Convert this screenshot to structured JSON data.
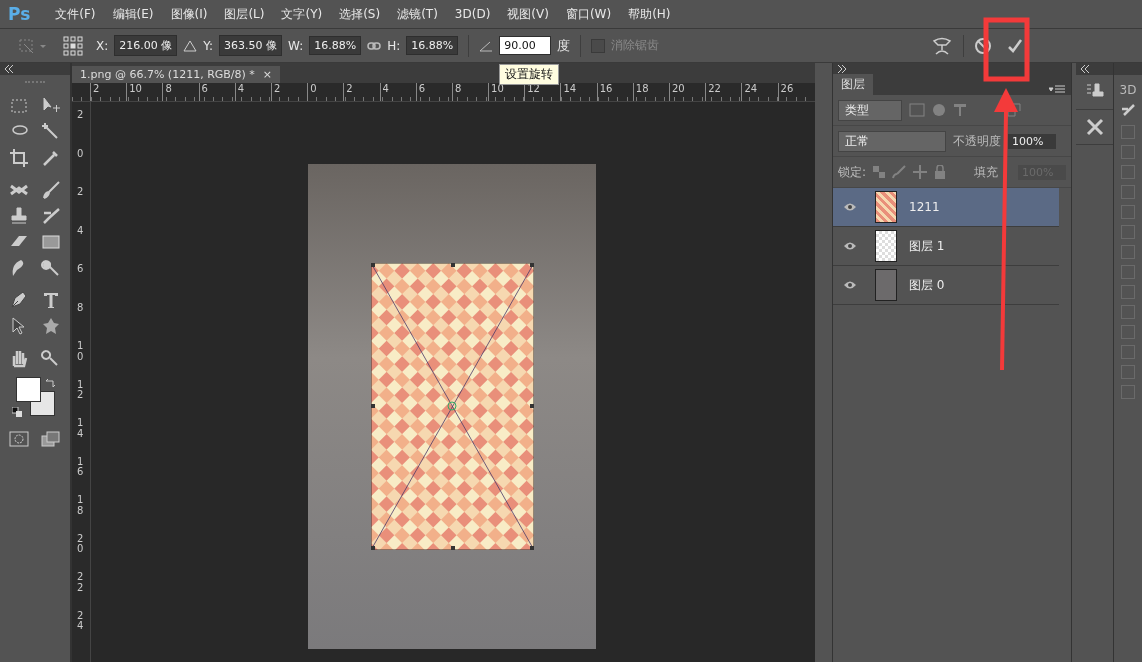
{
  "app": {
    "logo": "Ps"
  },
  "menu": [
    "文件(F)",
    "编辑(E)",
    "图像(I)",
    "图层(L)",
    "文字(Y)",
    "选择(S)",
    "滤镜(T)",
    "3D(D)",
    "视图(V)",
    "窗口(W)",
    "帮助(H)"
  ],
  "options": {
    "x_label": "X:",
    "x_value": "216.00 像",
    "y_label": "Y:",
    "y_value": "363.50 像",
    "w_label": "W:",
    "w_value": "16.88%",
    "h_label": "H:",
    "h_value": "16.88%",
    "angle_value": "90.00",
    "angle_unit": "度",
    "antialias": {
      "label": "消除锯齿",
      "checked": false,
      "disabled": true
    },
    "tooltip": "设置旋转"
  },
  "document_tab": {
    "title": "1.png @ 66.7% (1211, RGB/8) *",
    "close": "×"
  },
  "ruler_h": [
    "2",
    "10",
    "8",
    "6",
    "4",
    "2",
    "0",
    "2",
    "4",
    "6",
    "8",
    "10",
    "12",
    "14",
    "16",
    "18",
    "20",
    "22",
    "24",
    "26"
  ],
  "ruler_v": [
    "2",
    "0",
    "2",
    "4",
    "6",
    "8",
    "10",
    "12",
    "14",
    "16",
    "18",
    "20",
    "22",
    "24"
  ],
  "layers_panel": {
    "tab": "图层",
    "filter": "类型",
    "blend_mode": "正常",
    "opacity_label": "不透明度",
    "opacity": "100%",
    "lock_label": "锁定:",
    "fill_label": "填充",
    "fill": "100%",
    "layers": [
      {
        "name": "1211",
        "selected": true,
        "visible": true,
        "kind": "pattern"
      },
      {
        "name": "图层 1",
        "selected": false,
        "visible": true,
        "kind": "empty"
      },
      {
        "name": "图层 0",
        "selected": false,
        "visible": true,
        "kind": "photo"
      }
    ]
  },
  "dock": {
    "tab": "3D"
  }
}
